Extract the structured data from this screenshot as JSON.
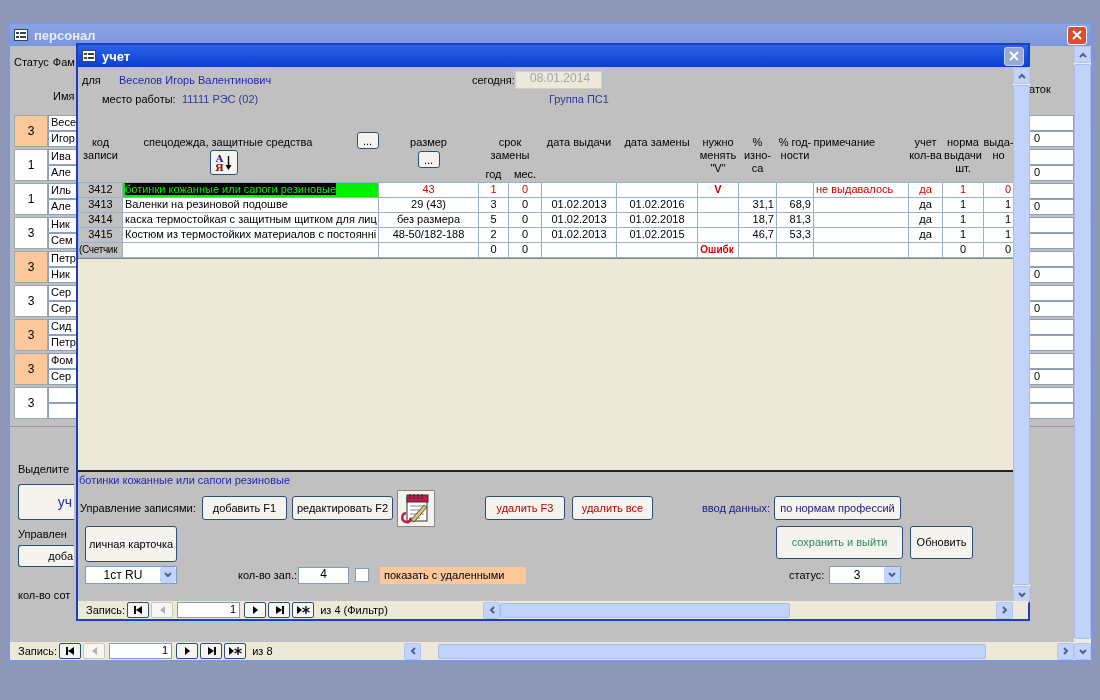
{
  "background_window": {
    "title": "персонал",
    "header_labels": [
      "Статус",
      "Фам",
      "Имя"
    ],
    "last_column_label": "аток",
    "rows": [
      {
        "status": "3",
        "highlighted": true,
        "first_line": "Весе",
        "second_line": "Игор",
        "last_value": "0"
      },
      {
        "status": "1",
        "highlighted": false,
        "first_line": "Ива",
        "second_line": "Але",
        "last_value": "0"
      },
      {
        "status": "1",
        "highlighted": false,
        "first_line": "Иль",
        "second_line": "Але",
        "last_value": "0"
      },
      {
        "status": "3",
        "highlighted": false,
        "first_line": "Ник",
        "second_line": "Сем"
      },
      {
        "status": "3",
        "highlighted": true,
        "first_line": "Петр",
        "second_line": "Ник",
        "last_value": "0"
      },
      {
        "status": "3",
        "highlighted": false,
        "first_line": "Сер",
        "second_line": "Сер",
        "last_value": "0"
      },
      {
        "status": "3",
        "highlighted": true,
        "first_line": "Сид",
        "second_line": "Петр"
      },
      {
        "status": "3",
        "highlighted": true,
        "first_line": "Фом",
        "second_line": "Сер",
        "last_value": "0"
      },
      {
        "status": "3",
        "highlighted": false
      }
    ],
    "hint_label": "Выделите",
    "open_button": "уч",
    "section_label": "Управлен",
    "add_button": "доба",
    "count_label": "кол-во сот",
    "navigation": {
      "label": "Запись:",
      "current": "1",
      "total": "из 8",
      "buttons": [
        {
          "kind": "first",
          "disabled": false
        },
        {
          "kind": "previous",
          "disabled": true
        },
        {
          "kind": "next",
          "disabled": false
        },
        {
          "kind": "last",
          "disabled": false
        },
        {
          "kind": "new",
          "disabled": false
        }
      ]
    }
  },
  "window": {
    "title": "учет",
    "employee": {
      "for_label": "для",
      "name": "Веселов Игорь Валентинович",
      "today_label": "сегодня:",
      "today": "08.01.2014",
      "workplace_label": "место работы:",
      "workplace": "11111 РЭС (02)",
      "group": "Группа ПС1"
    },
    "item_picker_button": "...",
    "size_picker_button": "...",
    "sort_button": {
      "top": "А",
      "bottom": "Я"
    },
    "columns": [
      {
        "label": "код записи"
      },
      {
        "label": "спецодежда, защитные средства"
      },
      {
        "label": "размер"
      },
      {
        "label": "срок замены",
        "colspan": 2,
        "sub_labels": [
          "год",
          "мес."
        ]
      },
      {
        "label": "дата выдачи"
      },
      {
        "label": "дата замены"
      },
      {
        "label": "нужно менять \"V\""
      },
      {
        "label": "% изно-са"
      },
      {
        "label": "% год-ности"
      },
      {
        "label": "примечание"
      },
      {
        "label": "учет кол-ва"
      },
      {
        "label": "норма выдачи шт."
      },
      {
        "label": "выда-но"
      }
    ],
    "rows": [
      {
        "kind": "item",
        "selected": true,
        "alert": true,
        "cells": [
          "3412",
          "ботинки кожанные или сапоги резиновые",
          "43",
          "1",
          "0",
          null,
          null,
          "V",
          null,
          null,
          "не выдавалось",
          "да",
          "1",
          "0"
        ]
      },
      {
        "kind": "item",
        "selected": false,
        "alert": false,
        "cells": [
          "3413",
          "Валенки на резиновой подошве",
          "29 (43)",
          "3",
          "0",
          "01.02.2013",
          "01.02.2016",
          null,
          "31,1",
          "68,9",
          null,
          "да",
          "1",
          "1"
        ]
      },
      {
        "kind": "item",
        "selected": false,
        "alert": false,
        "cells": [
          "3414",
          "каска термостойкая с защитным щитком для лиц",
          "без размера",
          "5",
          "0",
          "01.02.2013",
          "01.02.2018",
          null,
          "18,7",
          "81,3",
          null,
          "да",
          "1",
          "1"
        ]
      },
      {
        "kind": "item",
        "selected": false,
        "alert": false,
        "cells": [
          "3415",
          "Костюм из термостойких материалов с постоянні",
          "48-50/182-188",
          "2",
          "0",
          "01.02.2013",
          "01.02.2015",
          null,
          "46,7",
          "53,3",
          null,
          "да",
          "1",
          "1"
        ]
      },
      {
        "kind": "total",
        "selected": false,
        "alert": false,
        "cells": [
          "(Счетчик",
          null,
          null,
          "0",
          "0",
          null,
          null,
          "Ошибк",
          null,
          null,
          null,
          null,
          "0",
          "0"
        ]
      }
    ],
    "current_item": "ботинки кожанные или сапоги резиновые",
    "records_label": "Управление записями:",
    "add_button": "добавить F1",
    "edit_button": "редактировать F2",
    "delete_button": "удалить F3",
    "delete_all_button": "удалить все",
    "input_label": "ввод данных:",
    "norms_button": "по нормам профессий",
    "card_button": "личная карточка",
    "save_button": "сохранить и выйти",
    "refresh_button": "Обновить",
    "language": "1ст RU",
    "count_label": "кол-во зап.:",
    "count": "4",
    "show_deleted": {
      "checked": false,
      "label": "показать с удаленными"
    },
    "status_label": "статус:",
    "status": "3",
    "navigation": {
      "label": "Запись:",
      "current": "1",
      "total": "из 4 (Фильтр)",
      "buttons": [
        {
          "kind": "first",
          "disabled": false
        },
        {
          "kind": "previous",
          "disabled": true
        },
        {
          "kind": "next",
          "disabled": false
        },
        {
          "kind": "last",
          "disabled": false
        },
        {
          "kind": "new",
          "disabled": false
        }
      ]
    }
  }
}
